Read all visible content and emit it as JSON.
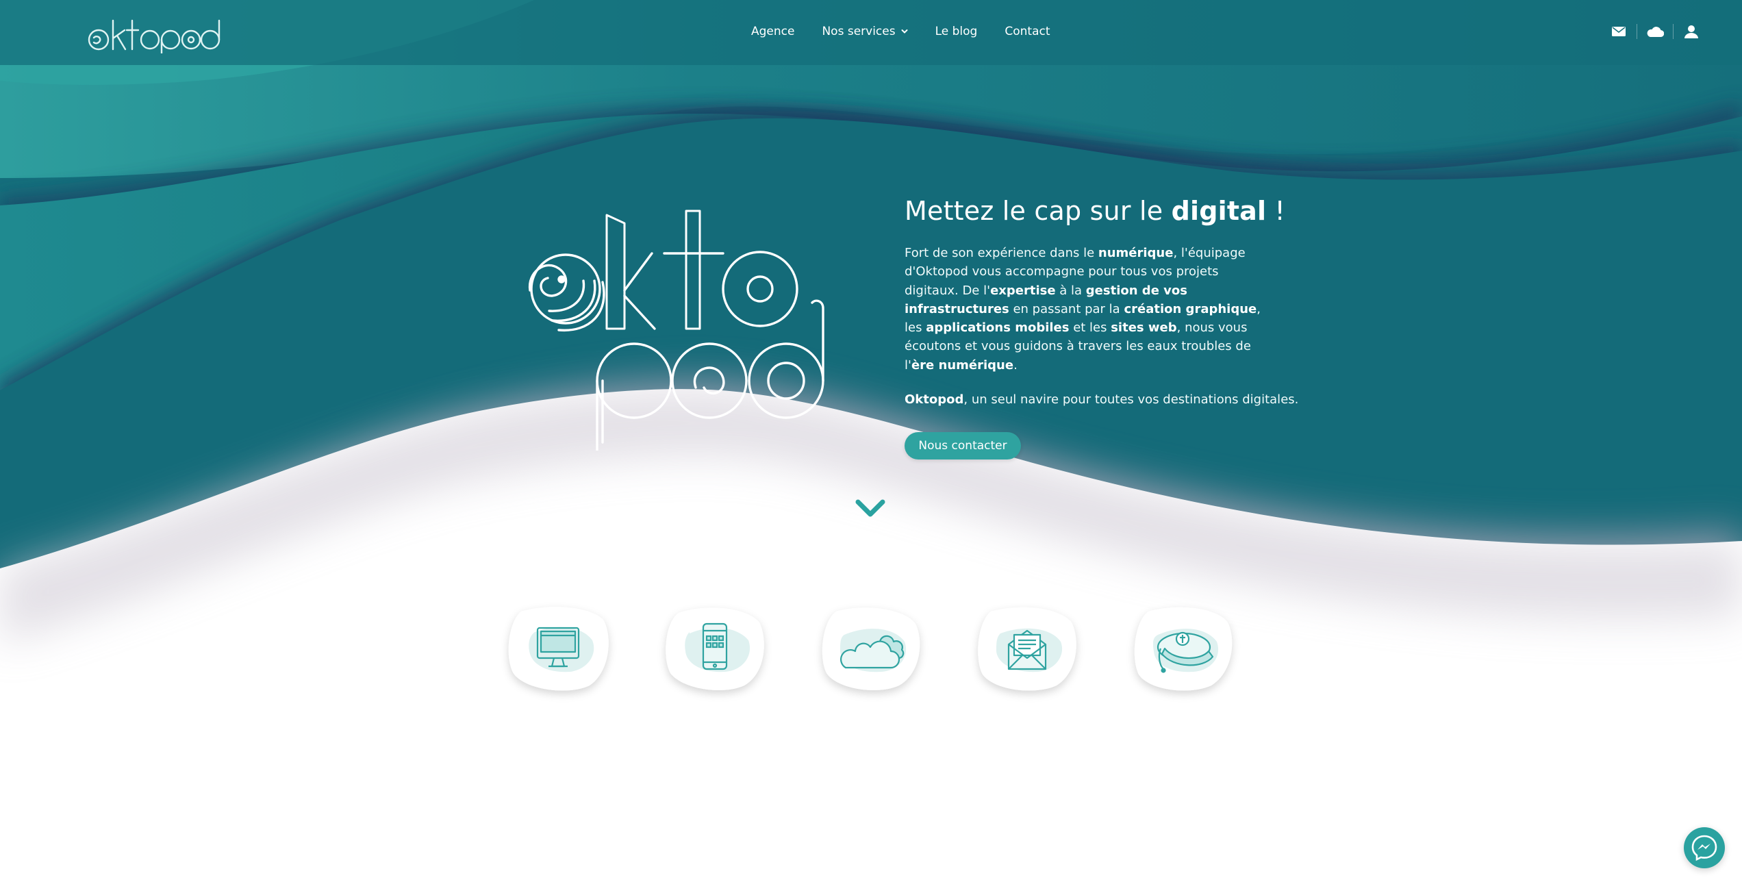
{
  "brand": {
    "name": "oktopod"
  },
  "nav": {
    "items": [
      {
        "label": "Agence"
      },
      {
        "label": "Nos services",
        "has_dropdown": true
      },
      {
        "label": "Le blog"
      },
      {
        "label": "Contact"
      }
    ]
  },
  "header_icons": [
    "envelope-icon",
    "cloud-icon",
    "user-icon"
  ],
  "hero": {
    "title_prefix": "Mettez le cap sur le ",
    "title_bold": "digital",
    "title_suffix": " !",
    "p1": [
      "Fort de son expérience dans le ",
      "numérique",
      ", l'équipage d'Oktopod vous accompagne pour tous vos projets digitaux. De l'",
      "expertise",
      " à la ",
      "gestion de vos infrastructures",
      " en passant par la ",
      "création graphique",
      ", les ",
      "applications mobiles",
      " et les ",
      "sites web",
      ", nous vous écoutons et vous guidons à travers les eaux troubles de l'",
      "ère numérique",
      "."
    ],
    "p2_bold": "Oktopod",
    "p2_rest": ", un seul navire pour toutes vos destinations digitales.",
    "cta_label": "Nous contacter"
  },
  "services": [
    {
      "icon": "desktop-icon"
    },
    {
      "icon": "smartphone-icon"
    },
    {
      "icon": "cloud-icon"
    },
    {
      "icon": "mail-icon"
    },
    {
      "icon": "captain-hat-icon"
    }
  ],
  "colors": {
    "deep_teal": "#136d7a",
    "mid_teal": "#1b8189",
    "light_teal": "#2fa3a0",
    "navy_shadow": "#1d3f63",
    "accent": "#2fa3a0"
  }
}
